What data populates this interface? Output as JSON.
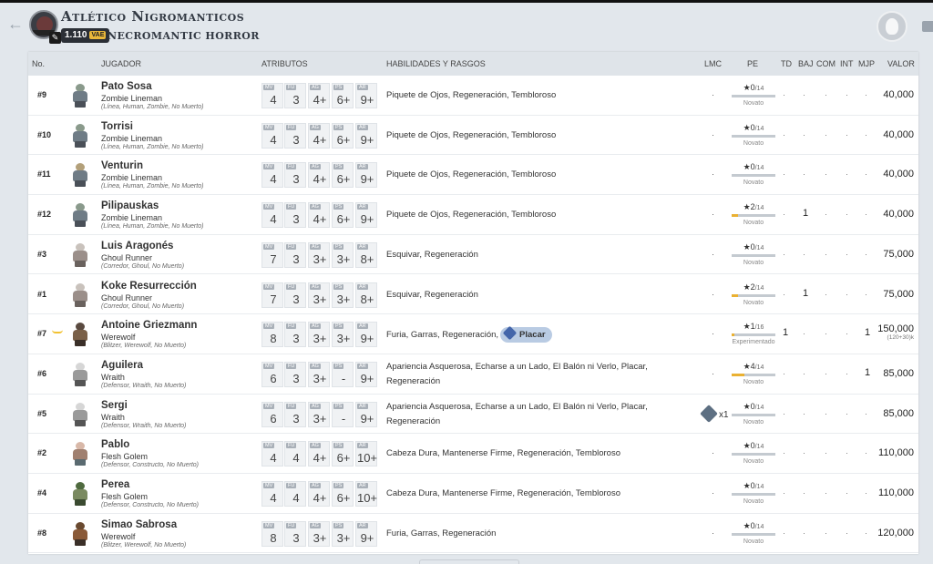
{
  "header": {
    "team_name": "Atlético Nigromanticos",
    "team_value": "1.110",
    "team_value_unit": "VAE",
    "race": "NECROMANTIC HORROR",
    "back_icon": "arrow-left-icon",
    "logo_icon": "team-crest-icon",
    "race_icon": "race-emblem-icon",
    "print_icon": "print-icon"
  },
  "columns": {
    "num": "No.",
    "player": "JUGADOR",
    "attributes": "ATRIBUTOS",
    "skills": "HABILIDADES Y RASGOS",
    "lmc": "LMC",
    "spp": "PE",
    "td": "TD",
    "cas": "BAJ",
    "comp": "COM",
    "int": "INT",
    "mvp": "MJP",
    "value": "VALOR"
  },
  "attr_labels": {
    "mv": "MV",
    "st": "FU",
    "ag": "AG",
    "pa": "PS",
    "av": "AR"
  },
  "dash": "·",
  "rows": [
    {
      "num": "#9",
      "name": "Pato Sosa",
      "position": "Zombie Lineman",
      "keywords": "(Línea, Human, Zombie, No Muerto)",
      "mv": "4",
      "st": "3",
      "ag": "4+",
      "pa": "6+",
      "av": "9+",
      "skills": "Piquete de Ojos, Regeneración, Tembloroso",
      "spp": "0",
      "spp_max": "/14",
      "level": "Novato",
      "td": "·",
      "cas": "·",
      "value": "40,000"
    },
    {
      "num": "#10",
      "name": "Torrisi",
      "position": "Zombie Lineman",
      "keywords": "(Línea, Human, Zombie, No Muerto)",
      "mv": "4",
      "st": "3",
      "ag": "4+",
      "pa": "6+",
      "av": "9+",
      "skills": "Piquete de Ojos, Regeneración, Tembloroso",
      "spp": "0",
      "spp_max": "/14",
      "level": "Novato",
      "td": "·",
      "cas": "·",
      "value": "40,000"
    },
    {
      "num": "#11",
      "name": "Venturin",
      "position": "Zombie Lineman",
      "keywords": "(Línea, Human, Zombie, No Muerto)",
      "mv": "4",
      "st": "3",
      "ag": "4+",
      "pa": "6+",
      "av": "9+",
      "skills": "Piquete de Ojos, Regeneración, Tembloroso",
      "spp": "0",
      "spp_max": "/14",
      "level": "Novato",
      "td": "·",
      "cas": "·",
      "value": "40,000"
    },
    {
      "num": "#12",
      "name": "Pilipauskas",
      "position": "Zombie Lineman",
      "keywords": "(Línea, Human, Zombie, No Muerto)",
      "mv": "4",
      "st": "3",
      "ag": "4+",
      "pa": "6+",
      "av": "9+",
      "skills": "Piquete de Ojos, Regeneración, Tembloroso",
      "spp": "2",
      "spp_max": "/14",
      "spp_fill": 0.14,
      "level": "Novato",
      "td": "·",
      "cas": "1",
      "value": "40,000"
    },
    {
      "num": "#3",
      "name": "Luis Aragonés",
      "position": "Ghoul Runner",
      "keywords": "(Corredor, Ghoul, No Muerto)",
      "mv": "7",
      "st": "3",
      "ag": "3+",
      "pa": "3+",
      "av": "8+",
      "skills": "Esquivar, Regeneración",
      "spp": "0",
      "spp_max": "/14",
      "level": "Novato",
      "td": "·",
      "cas": "·",
      "value": "75,000"
    },
    {
      "num": "#1",
      "name": "Koke Resurrección",
      "position": "Ghoul Runner",
      "keywords": "(Corredor, Ghoul, No Muerto)",
      "mv": "7",
      "st": "3",
      "ag": "3+",
      "pa": "3+",
      "av": "8+",
      "skills": "Esquivar, Regeneración",
      "spp": "2",
      "spp_max": "/14",
      "spp_fill": 0.14,
      "level": "Novato",
      "td": "·",
      "cas": "1",
      "value": "75,000"
    },
    {
      "num": "#7",
      "name": "Antoine Griezmann",
      "position": "Werewolf",
      "keywords": "(Blitzer, Werewolf, No Muerto)",
      "mv": "8",
      "st": "3",
      "ag": "3+",
      "pa": "3+",
      "av": "9+",
      "skills": "Furia, Garras, Regeneración,",
      "extra_skill": "Placar",
      "spp": "1",
      "spp_max": "/16",
      "spp_fill": 0.06,
      "level": "Experimentado",
      "td": "1",
      "cas": "·",
      "mvp": "1",
      "value": "150,000",
      "value_note": "(120+30)k"
    },
    {
      "num": "#6",
      "name": "Aguilera",
      "position": "Wraith",
      "keywords": "(Defensor, Wraith, No Muerto)",
      "mv": "6",
      "st": "3",
      "ag": "3+",
      "pa": "-",
      "av": "9+",
      "skills": "Apariencia Asquerosa, Echarse a un Lado, El Balón ni Verlo, Placar, Regeneración",
      "spp": "4",
      "spp_max": "/14",
      "spp_fill": 0.29,
      "level": "Novato",
      "td": "·",
      "cas": "·",
      "mvp": "1",
      "value": "85,000"
    },
    {
      "num": "#5",
      "name": "Sergi",
      "position": "Wraith",
      "keywords": "(Defensor, Wraith, No Muerto)",
      "mv": "6",
      "st": "3",
      "ag": "3+",
      "pa": "-",
      "av": "9+",
      "skills": "Apariencia Asquerosa, Echarse a un Lado, El Balón ni Verlo, Placar, Regeneración",
      "injury": "x1",
      "injury_icon": "injury-icon",
      "spp": "0",
      "spp_max": "/14",
      "level": "Novato",
      "td": "·",
      "cas": "·",
      "value": "85,000"
    },
    {
      "num": "#2",
      "name": "Pablo",
      "position": "Flesh Golem",
      "keywords": "(Defensor, Constructo, No Muerto)",
      "mv": "4",
      "st": "4",
      "ag": "4+",
      "pa": "6+",
      "av": "10+",
      "skills": "Cabeza Dura, Mantenerse Firme, Regeneración, Tembloroso",
      "spp": "0",
      "spp_max": "/14",
      "level": "Novato",
      "td": "·",
      "cas": "·",
      "value": "110,000"
    },
    {
      "num": "#4",
      "name": "Perea",
      "position": "Flesh Golem",
      "keywords": "(Defensor, Constructo, No Muerto)",
      "mv": "4",
      "st": "4",
      "ag": "4+",
      "pa": "6+",
      "av": "10+",
      "skills": "Cabeza Dura, Mantenerse Firme, Regeneración, Tembloroso",
      "spp": "0",
      "spp_max": "/14",
      "level": "Novato",
      "td": "·",
      "cas": "·",
      "value": "110,000"
    },
    {
      "num": "#8",
      "name": "Simao Sabrosa",
      "position": "Werewolf",
      "keywords": "(Blitzer, Werewolf, No Muerto)",
      "mv": "8",
      "st": "3",
      "ag": "3+",
      "pa": "3+",
      "av": "9+",
      "skills": "Furia, Garras, Regeneración",
      "spp": "0",
      "spp_max": "/14",
      "level": "Novato",
      "td": "·",
      "cas": "·",
      "value": "120,000"
    }
  ]
}
